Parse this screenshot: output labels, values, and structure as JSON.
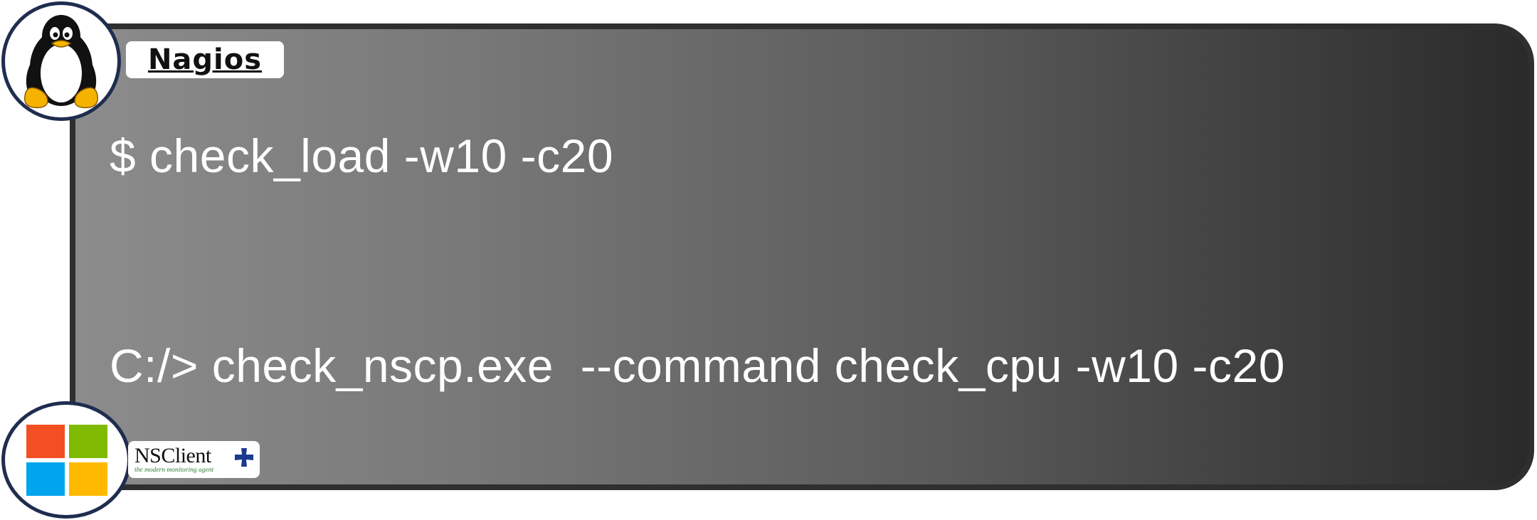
{
  "commands": {
    "linux": "$ check_load -w10 -c20",
    "windows": "C:/> check_nscp.exe  --command check_cpu -w10 -c20"
  },
  "logos": {
    "nagios_text": "Nagios",
    "nsclient_text": "NSClient",
    "nsclient_tagline": "the modern monitoring agent"
  },
  "icons": {
    "linux": "tux-penguin-icon",
    "windows": "windows-logo-icon",
    "nsclient_plus": "plus-icon"
  },
  "colors": {
    "panel_border": "#2f2f2f",
    "badge_border": "#1f2d4f",
    "windows_red": "#f25022",
    "windows_green": "#7fba00",
    "windows_blue": "#00a4ef",
    "windows_yellow": "#ffb900",
    "nsclient_plus": "#1a3a8f"
  }
}
